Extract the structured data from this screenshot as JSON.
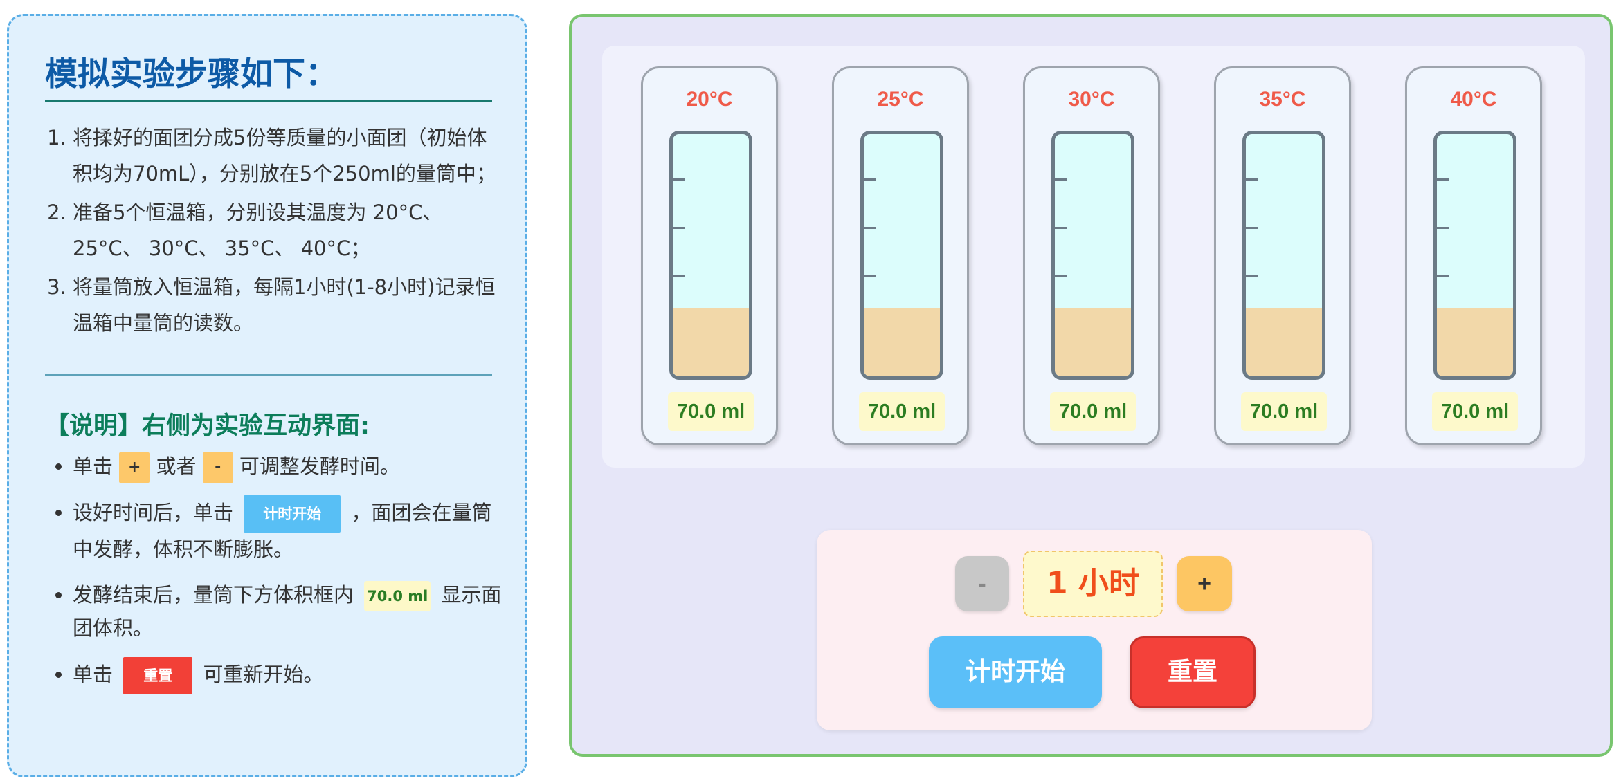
{
  "instructions": {
    "title": "模拟实验步骤如下：",
    "steps": [
      "将揉好的面团分成5份等质量的小面团（初始体积均为70mL），分别放在5个250ml的量筒中；",
      "准备5个恒温箱，分别设其温度为 20°C、 25°C、 30°C、 35°C、 40°C；",
      "将量筒放入恒温箱，每隔1小时(1-8小时)记录恒温箱中量筒的读数。"
    ],
    "note_title": "【说明】右侧为实验互动界面:",
    "notes": {
      "n1_prefix": "单击",
      "n1_plus": "+",
      "n1_mid": "或者",
      "n1_minus": "-",
      "n1_suffix": "可调整发酵时间。",
      "n2_prefix": "设好时间后，单击",
      "n2_chip": "计时开始",
      "n2_suffix": "，面团会在量筒中发酵，体积不断膨胀。",
      "n3_prefix": "发酵结束后，量筒下方体积框内",
      "n3_chip": "70.0 ml",
      "n3_suffix": "显示面团体积。",
      "n4_prefix": "单击",
      "n4_chip": "重置",
      "n4_suffix": "可重新开始。"
    }
  },
  "experiment": {
    "cylinders": [
      {
        "temp": "20°C",
        "volume": "70.0 ml",
        "fill_fraction": 0.28
      },
      {
        "temp": "25°C",
        "volume": "70.0 ml",
        "fill_fraction": 0.28
      },
      {
        "temp": "30°C",
        "volume": "70.0 ml",
        "fill_fraction": 0.28
      },
      {
        "temp": "35°C",
        "volume": "70.0 ml",
        "fill_fraction": 0.28
      },
      {
        "temp": "40°C",
        "volume": "70.0 ml",
        "fill_fraction": 0.28
      }
    ],
    "controls": {
      "minus_label": "-",
      "time_value": "1 小时",
      "plus_label": "+",
      "start_label": "计时开始",
      "reset_label": "重置"
    }
  },
  "colors": {
    "accent_blue": "#58bff5",
    "reset_red": "#f24037",
    "dough": "#f2d8a9",
    "temp_text": "#ef5a49",
    "volume_text": "#2c7d22"
  }
}
